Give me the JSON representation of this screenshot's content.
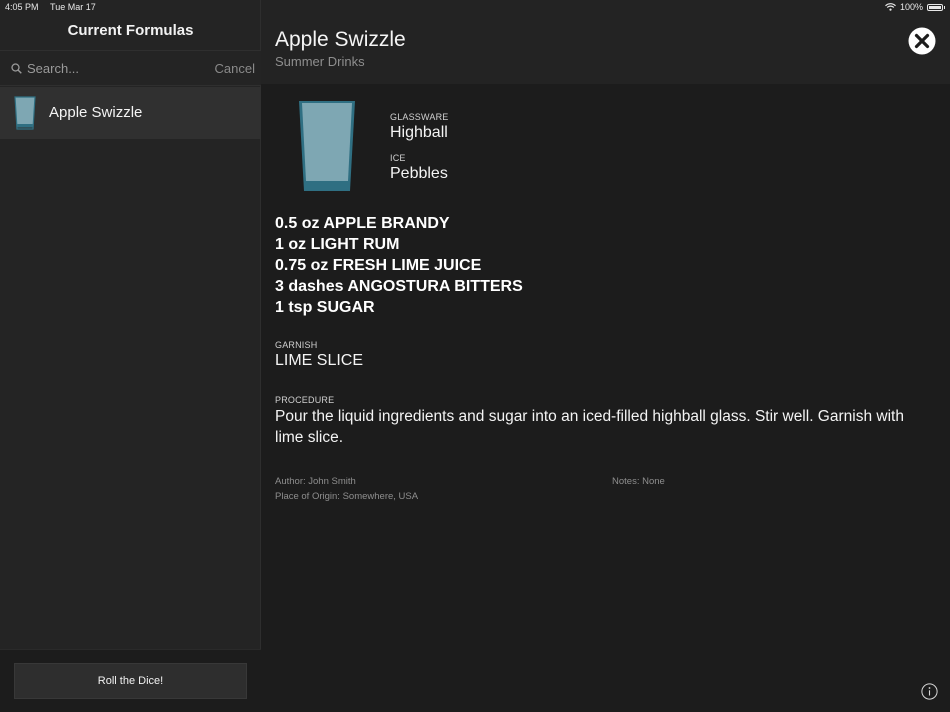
{
  "status_bar": {
    "time": "4:05 PM",
    "date": "Tue Mar 17",
    "battery": "100%",
    "icons": [
      "wifi-icon",
      "battery-icon"
    ]
  },
  "sidebar": {
    "title": "Current Formulas",
    "search": {
      "placeholder": "Search...",
      "value": "",
      "cancel_label": "Cancel"
    },
    "items": [
      {
        "label": "Apple Swizzle",
        "icon": "highball-glass-icon"
      }
    ],
    "footer_button": "Roll the Dice!"
  },
  "detail": {
    "title": "Apple Swizzle",
    "subtitle": "Summer Drinks",
    "glassware_label": "GLASSWARE",
    "glassware": "Highball",
    "ice_label": "ICE",
    "ice": "Pebbles",
    "ingredients": [
      "0.5 oz APPLE BRANDY",
      "1 oz LIGHT RUM",
      "0.75 oz FRESH LIME JUICE",
      "3 dashes ANGOSTURA BITTERS",
      "1 tsp SUGAR"
    ],
    "garnish_label": "GARNISH",
    "garnish": "LIME SLICE",
    "procedure_label": "PROCEDURE",
    "procedure": "Pour the liquid ingredients and sugar into an iced-filled highball glass. Stir well. Garnish with lime slice.",
    "author": "Author: John Smith",
    "origin": "Place of Origin: Somewhere, USA",
    "notes": "Notes: None"
  },
  "colors": {
    "background": "#1c1c1c",
    "sidebar": "#242424",
    "selected_row": "#303030",
    "glass_fill": "#7ea7b3",
    "glass_base": "#2f6f82"
  }
}
